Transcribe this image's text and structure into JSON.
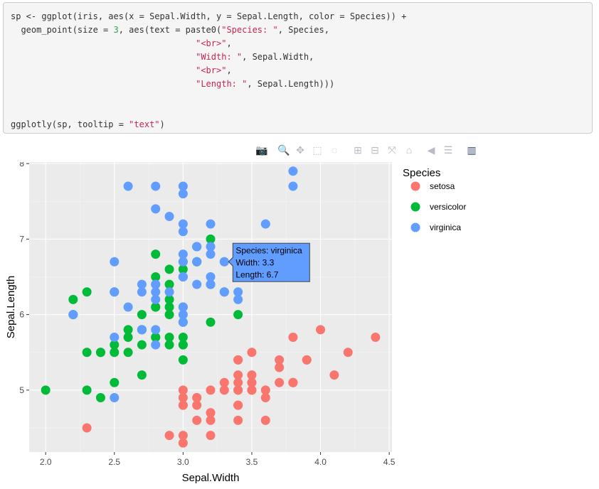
{
  "code": {
    "lines": [
      [
        {
          "t": "sp <- ggplot(iris, aes(x = Sepal.Width, y = Sepal.Length, color = Species)) +"
        }
      ],
      [
        {
          "t": "  geom_point(size = "
        },
        {
          "t": "3",
          "c": "num"
        },
        {
          "t": ", aes(text = paste0("
        },
        {
          "t": "\"Species: \"",
          "c": "str"
        },
        {
          "t": ", Species,"
        }
      ],
      [
        {
          "t": "                                    "
        },
        {
          "t": "\"<br>\"",
          "c": "str"
        },
        {
          "t": ","
        }
      ],
      [
        {
          "t": "                                    "
        },
        {
          "t": "\"Width: \"",
          "c": "str"
        },
        {
          "t": ", Sepal.Width,"
        }
      ],
      [
        {
          "t": "                                    "
        },
        {
          "t": "\"<br>\"",
          "c": "str"
        },
        {
          "t": ","
        }
      ],
      [
        {
          "t": "                                    "
        },
        {
          "t": "\"Length: \"",
          "c": "str"
        },
        {
          "t": ", Sepal.Length)))"
        }
      ],
      [
        {
          "t": ""
        }
      ],
      [
        {
          "t": ""
        }
      ],
      [
        {
          "t": "ggplotly(sp, tooltip = "
        },
        {
          "t": "\"text\"",
          "c": "str"
        },
        {
          "t": ")"
        }
      ]
    ]
  },
  "toolbar": {
    "buttons": [
      {
        "name": "camera-icon",
        "glyph": "📷",
        "active": false
      },
      {
        "name": "zoom-icon",
        "glyph": "🔍",
        "active": true
      },
      {
        "name": "pan-icon",
        "glyph": "✥",
        "active": false
      },
      {
        "name": "box-select-icon",
        "glyph": "⬚",
        "active": false
      },
      {
        "name": "lasso-select-icon",
        "glyph": "◌",
        "active": false
      },
      {
        "name": "zoom-in-icon",
        "glyph": "⊞",
        "active": false
      },
      {
        "name": "zoom-out-icon",
        "glyph": "⊟",
        "active": false
      },
      {
        "name": "autoscale-icon",
        "glyph": "⤧",
        "active": false
      },
      {
        "name": "reset-axes-icon",
        "glyph": "⌂",
        "active": false
      },
      {
        "name": "hover-closest-icon",
        "glyph": "◀",
        "active": false
      },
      {
        "name": "hover-compare-icon",
        "glyph": "☰",
        "active": false
      },
      {
        "name": "plotly-logo-icon",
        "glyph": "▥",
        "active": false
      }
    ]
  },
  "chart_data": {
    "type": "scatter",
    "xlabel": "Sepal.Width",
    "ylabel": "Sepal.Length",
    "xlim": [
      1.88,
      4.52
    ],
    "ylim": [
      4.18,
      8.02
    ],
    "xticks": [
      2.0,
      2.5,
      3.0,
      3.5,
      4.0,
      4.5
    ],
    "xtick_labels": [
      "2.0",
      "2.5",
      "3.0",
      "3.5",
      "4.0",
      "4.5"
    ],
    "yticks": [
      5,
      6,
      7,
      8
    ],
    "ytick_labels": [
      "5",
      "6",
      "7",
      "8"
    ],
    "grid": true,
    "legend": {
      "title": "Species",
      "position": "right"
    },
    "series": [
      {
        "name": "setosa",
        "color": "#F8766D",
        "points": [
          [
            3.5,
            5.1
          ],
          [
            3.0,
            4.9
          ],
          [
            3.2,
            4.7
          ],
          [
            3.1,
            4.6
          ],
          [
            3.6,
            5.0
          ],
          [
            3.9,
            5.4
          ],
          [
            3.4,
            4.6
          ],
          [
            3.4,
            5.0
          ],
          [
            2.9,
            4.4
          ],
          [
            3.1,
            4.9
          ],
          [
            3.7,
            5.4
          ],
          [
            3.4,
            4.8
          ],
          [
            3.0,
            4.8
          ],
          [
            3.0,
            4.3
          ],
          [
            4.0,
            5.8
          ],
          [
            4.4,
            5.7
          ],
          [
            3.9,
            5.4
          ],
          [
            3.5,
            5.1
          ],
          [
            3.8,
            5.7
          ],
          [
            3.8,
            5.1
          ],
          [
            3.4,
            5.4
          ],
          [
            3.7,
            5.1
          ],
          [
            3.6,
            4.6
          ],
          [
            3.3,
            5.1
          ],
          [
            3.4,
            4.8
          ],
          [
            3.0,
            5.0
          ],
          [
            3.4,
            5.0
          ],
          [
            3.5,
            5.2
          ],
          [
            3.4,
            5.2
          ],
          [
            3.2,
            4.7
          ],
          [
            3.1,
            4.8
          ],
          [
            3.4,
            5.4
          ],
          [
            4.1,
            5.2
          ],
          [
            4.2,
            5.5
          ],
          [
            3.1,
            4.9
          ],
          [
            3.2,
            5.0
          ],
          [
            3.5,
            5.5
          ],
          [
            3.6,
            4.9
          ],
          [
            3.0,
            4.4
          ],
          [
            3.4,
            5.1
          ],
          [
            3.5,
            5.0
          ],
          [
            2.3,
            4.5
          ],
          [
            3.2,
            4.4
          ],
          [
            3.5,
            5.0
          ],
          [
            3.8,
            5.1
          ],
          [
            3.0,
            4.8
          ],
          [
            3.8,
            5.1
          ],
          [
            3.2,
            4.6
          ],
          [
            3.7,
            5.3
          ],
          [
            3.3,
            5.0
          ]
        ]
      },
      {
        "name": "versicolor",
        "color": "#00BA38",
        "points": [
          [
            3.2,
            7.0
          ],
          [
            3.2,
            6.4
          ],
          [
            3.1,
            6.9
          ],
          [
            2.3,
            5.5
          ],
          [
            2.8,
            6.5
          ],
          [
            2.8,
            5.7
          ],
          [
            3.3,
            6.3
          ],
          [
            2.4,
            4.9
          ],
          [
            2.9,
            6.6
          ],
          [
            2.7,
            5.2
          ],
          [
            2.0,
            5.0
          ],
          [
            3.0,
            5.9
          ],
          [
            2.2,
            6.0
          ],
          [
            2.9,
            6.1
          ],
          [
            2.9,
            5.6
          ],
          [
            3.1,
            6.7
          ],
          [
            3.0,
            5.6
          ],
          [
            2.7,
            5.8
          ],
          [
            2.2,
            6.2
          ],
          [
            2.5,
            5.6
          ],
          [
            3.2,
            5.9
          ],
          [
            2.8,
            6.1
          ],
          [
            2.5,
            6.3
          ],
          [
            2.8,
            6.1
          ],
          [
            2.9,
            6.4
          ],
          [
            3.0,
            6.6
          ],
          [
            2.8,
            6.8
          ],
          [
            3.0,
            6.7
          ],
          [
            2.9,
            6.0
          ],
          [
            2.6,
            5.7
          ],
          [
            2.4,
            5.5
          ],
          [
            2.4,
            5.5
          ],
          [
            2.7,
            5.8
          ],
          [
            2.7,
            6.0
          ],
          [
            3.0,
            5.4
          ],
          [
            3.4,
            6.0
          ],
          [
            3.1,
            6.7
          ],
          [
            2.3,
            6.3
          ],
          [
            3.0,
            5.6
          ],
          [
            2.5,
            5.5
          ],
          [
            2.6,
            5.5
          ],
          [
            3.0,
            6.1
          ],
          [
            2.6,
            5.8
          ],
          [
            2.3,
            5.0
          ],
          [
            2.7,
            5.6
          ],
          [
            3.0,
            5.7
          ],
          [
            2.9,
            5.7
          ],
          [
            2.9,
            6.2
          ],
          [
            2.5,
            5.1
          ],
          [
            2.8,
            5.7
          ]
        ]
      },
      {
        "name": "virginica",
        "color": "#619CFF",
        "points": [
          [
            3.3,
            6.3
          ],
          [
            2.7,
            5.8
          ],
          [
            3.0,
            7.1
          ],
          [
            2.9,
            6.3
          ],
          [
            3.0,
            6.5
          ],
          [
            3.0,
            7.6
          ],
          [
            2.5,
            4.9
          ],
          [
            2.9,
            7.3
          ],
          [
            2.5,
            6.7
          ],
          [
            3.6,
            7.2
          ],
          [
            3.2,
            6.5
          ],
          [
            2.7,
            6.4
          ],
          [
            3.0,
            6.8
          ],
          [
            2.5,
            5.7
          ],
          [
            2.8,
            5.8
          ],
          [
            3.2,
            6.4
          ],
          [
            3.0,
            6.5
          ],
          [
            3.8,
            7.7
          ],
          [
            2.6,
            7.7
          ],
          [
            2.2,
            6.0
          ],
          [
            3.2,
            6.9
          ],
          [
            2.8,
            5.6
          ],
          [
            2.8,
            7.7
          ],
          [
            2.7,
            6.3
          ],
          [
            3.3,
            6.7
          ],
          [
            3.2,
            7.2
          ],
          [
            2.8,
            6.2
          ],
          [
            3.0,
            6.1
          ],
          [
            2.8,
            6.4
          ],
          [
            3.0,
            7.2
          ],
          [
            2.8,
            7.4
          ],
          [
            3.8,
            7.9
          ],
          [
            2.8,
            6.4
          ],
          [
            2.8,
            6.3
          ],
          [
            2.6,
            6.1
          ],
          [
            3.0,
            7.7
          ],
          [
            3.4,
            6.3
          ],
          [
            3.1,
            6.4
          ],
          [
            3.0,
            6.0
          ],
          [
            3.1,
            6.9
          ],
          [
            3.1,
            6.7
          ],
          [
            3.1,
            6.9
          ],
          [
            2.7,
            5.8
          ],
          [
            3.2,
            6.8
          ],
          [
            3.3,
            6.7
          ],
          [
            3.0,
            6.7
          ],
          [
            2.5,
            6.3
          ],
          [
            3.0,
            6.5
          ],
          [
            3.4,
            6.2
          ],
          [
            3.0,
            5.9
          ]
        ]
      }
    ],
    "tooltip": {
      "point": [
        3.3,
        6.7
      ],
      "series": "virginica",
      "lines": [
        "Species: virginica",
        "Width: 3.3",
        "Length: 6.7"
      ]
    }
  }
}
